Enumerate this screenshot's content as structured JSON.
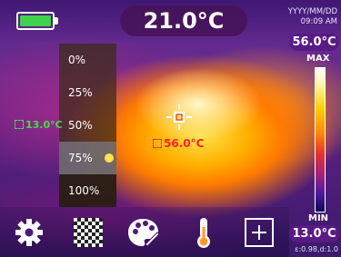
{
  "status": {
    "center_temperature": "21.0°C",
    "date": "YYYY/MM/DD",
    "time": "09:09 AM",
    "battery_level": 1.0
  },
  "scale": {
    "max_value": "56.0°C",
    "max_label": "MAX",
    "min_label": "MIN",
    "min_value": "13.0°C",
    "emissivity": "ε:0.98,d:1.0"
  },
  "spots": {
    "min_temp": "13.0°C",
    "max_temp": "56.0°C"
  },
  "blend_menu": {
    "options": [
      "0%",
      "25%",
      "50%",
      "75%",
      "100%"
    ],
    "selected": "75%"
  },
  "toolbar": {
    "icons": [
      "gear-icon",
      "checkerboard-icon",
      "palette-icon",
      "thermometer-icon",
      "center-point-icon"
    ]
  },
  "colors": {
    "battery": "#3fd24a",
    "min_spot": "#3fe040",
    "max_spot": "#ff2030",
    "badge": "#5a1a86"
  }
}
